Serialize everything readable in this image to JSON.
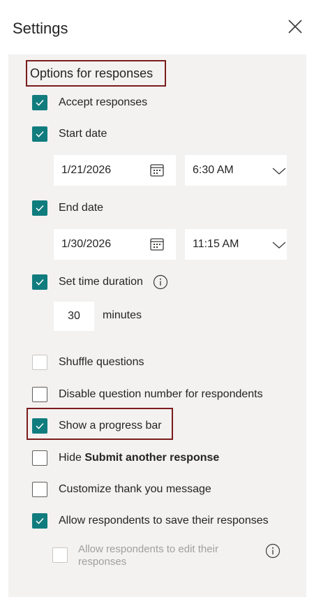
{
  "header": {
    "title": "Settings"
  },
  "section": {
    "title": "Options for responses"
  },
  "options": {
    "accept_responses": {
      "label": "Accept responses",
      "checked": true
    },
    "start_date": {
      "label": "Start date",
      "checked": true,
      "date": "1/21/2026",
      "time": "6:30 AM"
    },
    "end_date": {
      "label": "End date",
      "checked": true,
      "date": "1/30/2026",
      "time": "11:15 AM"
    },
    "time_duration": {
      "label": "Set time duration",
      "checked": true,
      "value": "30",
      "unit": "minutes"
    },
    "shuffle_questions": {
      "label": "Shuffle questions",
      "checked": false
    },
    "disable_question_number": {
      "label": "Disable question number for respondents",
      "checked": false
    },
    "show_progress_bar": {
      "label": "Show a progress bar",
      "checked": true
    },
    "hide_submit_another": {
      "label_prefix": "Hide ",
      "label_bold": "Submit another response",
      "checked": false
    },
    "customize_thank_you": {
      "label": "Customize thank you message",
      "checked": false
    },
    "allow_save": {
      "label": "Allow respondents to save their responses",
      "checked": true
    },
    "allow_edit": {
      "label": "Allow respondents to edit their responses",
      "checked": false,
      "disabled": true
    }
  },
  "colors": {
    "accent": "#117c7e",
    "highlight_border": "#7a1c1c",
    "panel_bg": "#f3f2f1"
  }
}
